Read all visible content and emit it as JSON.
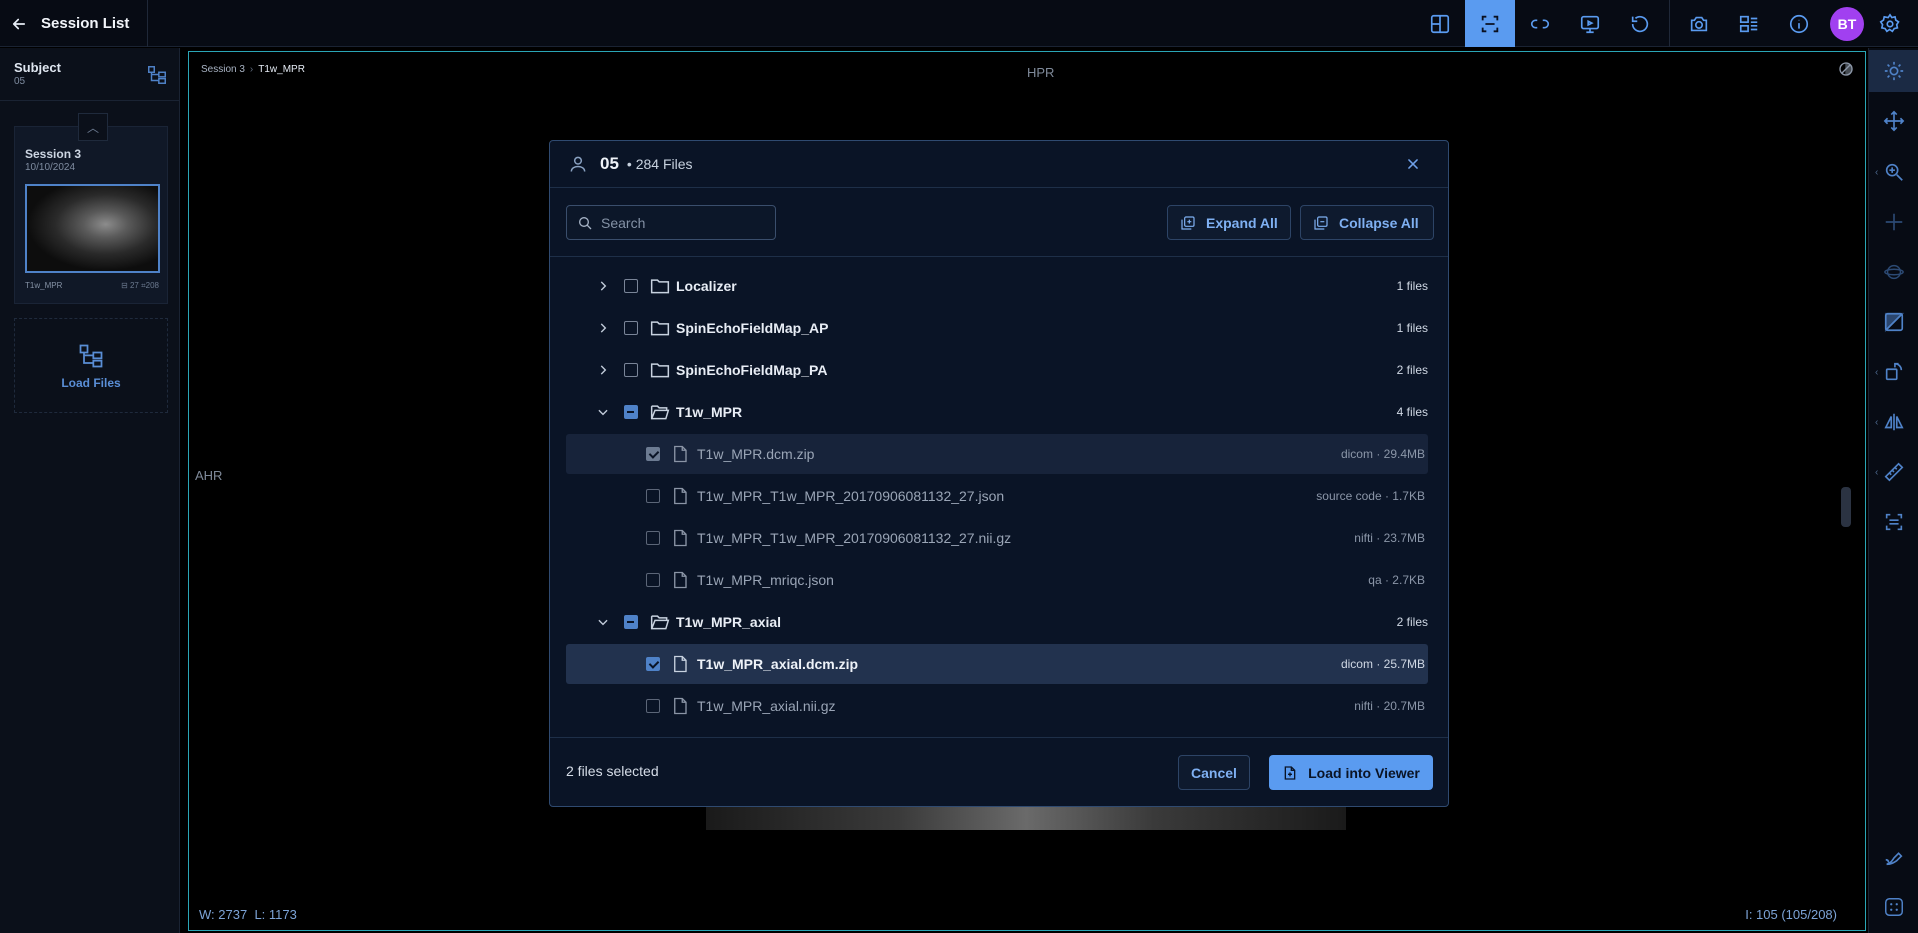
{
  "header": {
    "title": "Session List",
    "avatar_initials": "BT",
    "accent": "#5a9bf0"
  },
  "sidebar": {
    "subject_label": "Subject",
    "subject_id": "05",
    "session": {
      "name": "Session 3",
      "date": "10/10/2024",
      "series_label": "T1w_MPR",
      "stat_a": "27",
      "stat_b": "208"
    },
    "load_files_label": "Load Files"
  },
  "viewport": {
    "breadcrumb_session": "Session 3",
    "breadcrumb_series": "T1w_MPR",
    "orient_top": "HPR",
    "orient_left": "AHR",
    "window_label": "W:",
    "window_value": "2737",
    "level_label": "L:",
    "level_value": "1173",
    "image_index": "I: 105 (105/208)"
  },
  "modal": {
    "subject": "05",
    "file_count": "• 284 Files",
    "search_placeholder": "Search",
    "expand_all": "Expand All",
    "collapse_all": "Collapse All",
    "rows": [
      {
        "type": "folder",
        "name": "Localizer",
        "count": "1 files",
        "expanded": false,
        "state": "unchecked"
      },
      {
        "type": "folder",
        "name": "SpinEchoFieldMap_AP",
        "count": "1 files",
        "expanded": false,
        "state": "unchecked"
      },
      {
        "type": "folder",
        "name": "SpinEchoFieldMap_PA",
        "count": "2 files",
        "expanded": false,
        "state": "unchecked"
      },
      {
        "type": "folder",
        "name": "T1w_MPR",
        "count": "4 files",
        "expanded": true,
        "state": "partial"
      },
      {
        "type": "file",
        "name": "T1w_MPR.dcm.zip",
        "meta": "dicom · 29.4MB",
        "state": "checked-dim"
      },
      {
        "type": "file",
        "name": "T1w_MPR_T1w_MPR_20170906081132_27.json",
        "meta": "source code · 1.7KB",
        "state": "unchecked"
      },
      {
        "type": "file",
        "name": "T1w_MPR_T1w_MPR_20170906081132_27.nii.gz",
        "meta": "nifti · 23.7MB",
        "state": "unchecked"
      },
      {
        "type": "file",
        "name": "T1w_MPR_mriqc.json",
        "meta": "qa · 2.7KB",
        "state": "unchecked"
      },
      {
        "type": "folder",
        "name": "T1w_MPR_axial",
        "count": "2 files",
        "expanded": true,
        "state": "partial"
      },
      {
        "type": "file",
        "name": "T1w_MPR_axial.dcm.zip",
        "meta": "dicom · 25.7MB",
        "state": "checked"
      },
      {
        "type": "file",
        "name": "T1w_MPR_axial.nii.gz",
        "meta": "nifti · 20.7MB",
        "state": "unchecked"
      }
    ],
    "selected_text": "2 files selected",
    "cancel": "Cancel",
    "load": "Load into Viewer"
  }
}
